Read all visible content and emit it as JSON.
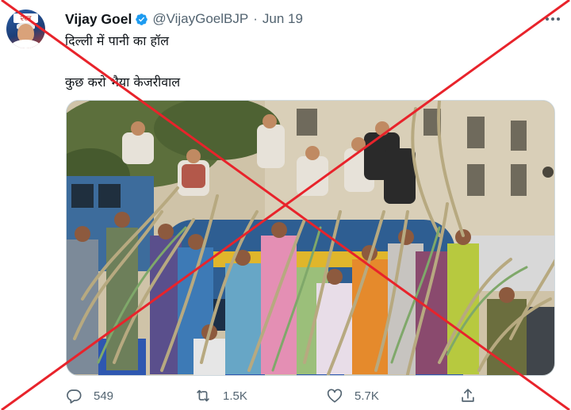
{
  "tweet": {
    "author_name": "Vijay Goel",
    "handle": "@VijayGoelBJP",
    "separator": "·",
    "date": "Jun 19",
    "line1": "दिल्ली में पानी का हॉल",
    "line2": "कुछ करो भैया केजरीवाल",
    "avatar_logo_text": "ਦਦਭ"
  },
  "icons": {
    "verified": "verified-badge-icon",
    "more": "more-options-icon",
    "reply": "reply-icon",
    "retweet": "retweet-icon",
    "like": "like-icon",
    "share": "share-icon"
  },
  "actions": {
    "reply_count": "549",
    "retweet_count": "1.5K",
    "like_count": "5.7K"
  },
  "colors": {
    "verified_blue": "#1d9bf0",
    "secondary_text": "#536471",
    "overlay_cross_red": "#e8232b"
  }
}
